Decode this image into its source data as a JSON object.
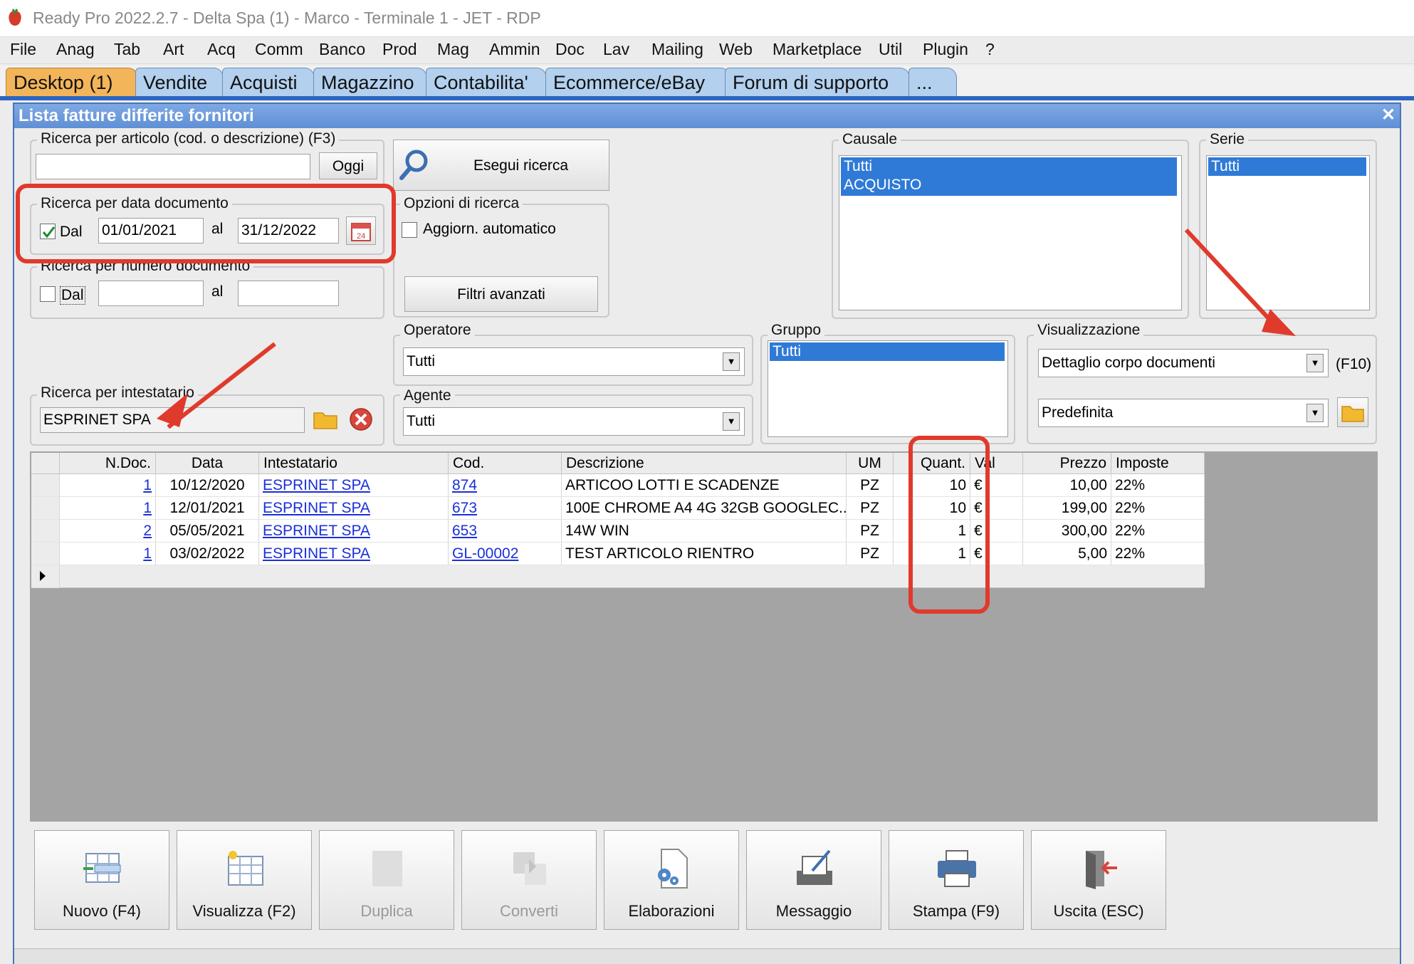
{
  "window": {
    "title": "Ready Pro 2022.2.7 - Delta Spa (1) - Marco - Terminale 1 - JET - RDP"
  },
  "menu": [
    "File",
    "Anag",
    "Tab",
    "Art",
    "Acq",
    "Comm",
    "Banco",
    "Prod",
    "Mag",
    "Ammin",
    "Doc",
    "Lav",
    "Mailing",
    "Web",
    "Marketplace",
    "Util",
    "Plugin",
    "?"
  ],
  "tabs": [
    "Desktop (1)",
    "Vendite",
    "Acquisti",
    "Magazzino",
    "Contabilita'",
    "Ecommerce/eBay",
    "Forum di supporto",
    "..."
  ],
  "form": {
    "title": "Lista fatture differite fornitori",
    "search_article": {
      "label": "Ricerca per articolo (cod. o descrizione) (F3)",
      "value": "",
      "today_btn": "Oggi"
    },
    "search_button": "Esegui ricerca",
    "search_date": {
      "label": "Ricerca per data documento",
      "from_label": "Dal",
      "from": "01/01/2021",
      "to_label": "al",
      "to": "31/12/2022",
      "checked": true
    },
    "search_number": {
      "label": "Ricerca per numero documento",
      "from_label": "Dal",
      "from": "",
      "to_label": "al",
      "to": ""
    },
    "options": {
      "label": "Opzioni di ricerca",
      "auto_update": "Aggiorn. automatico",
      "advanced_filters": "Filtri avanzati"
    },
    "operatore": {
      "label": "Operatore",
      "value": "Tutti"
    },
    "agente": {
      "label": "Agente",
      "value": "Tutti"
    },
    "intestatario": {
      "label": "Ricerca per intestatario",
      "value": "ESPRINET SPA"
    },
    "causale": {
      "label": "Causale",
      "items": [
        "Tutti",
        "ACQUISTO"
      ]
    },
    "serie": {
      "label": "Serie",
      "items": [
        "Tutti"
      ]
    },
    "gruppo": {
      "label": "Gruppo",
      "items": [
        "Tutti"
      ]
    },
    "visualizzazione": {
      "label": "Visualizzazione",
      "value": "Dettaglio corpo documenti",
      "shortcut": "(F10)",
      "layout": "Predefinita"
    }
  },
  "table": {
    "columns": [
      "N.Doc.",
      "Data",
      "Intestatario",
      "Cod.",
      "Descrizione",
      "UM",
      "Quant.",
      "Val",
      "Prezzo",
      "Imposte"
    ],
    "rows": [
      [
        "1",
        "10/12/2020",
        "ESPRINET SPA",
        "874",
        "ARTICOO LOTTI E SCADENZE",
        "PZ",
        "10",
        "€",
        "10,00",
        "22%"
      ],
      [
        "1",
        "12/01/2021",
        "ESPRINET SPA",
        "673",
        "100E CHROME A4 4G 32GB GOOGLEC...",
        "PZ",
        "10",
        "€",
        "199,00",
        "22%"
      ],
      [
        "2",
        "05/05/2021",
        "ESPRINET SPA",
        "653",
        "14W WIN",
        "PZ",
        "1",
        "€",
        "300,00",
        "22%"
      ],
      [
        "1",
        "03/02/2022",
        "ESPRINET SPA",
        "GL-00002",
        "TEST ARTICOLO RIENTRO",
        "PZ",
        "1",
        "€",
        "5,00",
        "22%"
      ]
    ]
  },
  "buttons": [
    {
      "label": "Nuovo (F4)",
      "icon": "new-document-icon",
      "enabled": true
    },
    {
      "label": "Visualizza (F2)",
      "icon": "view-document-icon",
      "enabled": true
    },
    {
      "label": "Duplica",
      "icon": "duplicate-icon",
      "enabled": false
    },
    {
      "label": "Converti",
      "icon": "convert-icon",
      "enabled": false
    },
    {
      "label": "Elaborazioni",
      "icon": "gear-document-icon",
      "enabled": true
    },
    {
      "label": "Messaggio",
      "icon": "message-icon",
      "enabled": true
    },
    {
      "label": "Stampa (F9)",
      "icon": "printer-icon",
      "enabled": true
    },
    {
      "label": "Uscita (ESC)",
      "icon": "exit-icon",
      "enabled": true
    }
  ],
  "colors": {
    "accent": "#2f7ad6",
    "annotation": "#e03a2c",
    "active_tab": "#f3b55a",
    "tab": "#b3d0ee"
  }
}
